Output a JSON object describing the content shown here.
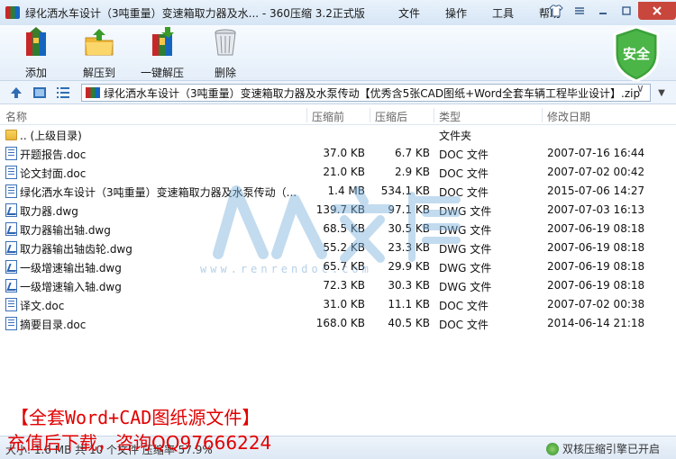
{
  "window": {
    "title": "绿化洒水车设计（3吨重量）变速箱取力器及水... - 360压缩 3.2正式版",
    "menu": [
      "文件",
      "操作",
      "工具",
      "帮助"
    ]
  },
  "toolbar": {
    "add": "添加",
    "extract_to": "解压到",
    "one_click_extract": "一键解压",
    "delete": "删除",
    "security_badge": "安全"
  },
  "address": {
    "path": "绿化洒水车设计（3吨重量）变速箱取力器及水泵传动【优秀含5张CAD图纸+Word全套车辆工程毕业设计】.zip"
  },
  "columns": {
    "name": "名称",
    "compressed": "压缩前",
    "packed": "压缩后",
    "type": "类型",
    "modified": "修改日期"
  },
  "files": [
    {
      "name": ".. (上级目录)",
      "icon": "folder-icon",
      "size": "",
      "packed": "",
      "type": "文件夹",
      "date": ""
    },
    {
      "name": "开题报告.doc",
      "icon": "doc-icon",
      "size": "37.0 KB",
      "packed": "6.7 KB",
      "type": "DOC 文件",
      "date": "2007-07-16 16:44"
    },
    {
      "name": "论文封面.doc",
      "icon": "doc-icon",
      "size": "21.0 KB",
      "packed": "2.9 KB",
      "type": "DOC 文件",
      "date": "2007-07-02 00:42"
    },
    {
      "name": "绿化洒水车设计（3吨重量）变速箱取力器及水泵传动（...",
      "icon": "doc-icon",
      "size": "1.4 MB",
      "packed": "534.1 KB",
      "type": "DOC 文件",
      "date": "2015-07-06 14:27"
    },
    {
      "name": "取力器.dwg",
      "icon": "dwg-icon",
      "size": "139.7 KB",
      "packed": "97.1 KB",
      "type": "DWG 文件",
      "date": "2007-07-03 16:13"
    },
    {
      "name": "取力器输出轴.dwg",
      "icon": "dwg-icon",
      "size": "68.5 KB",
      "packed": "30.5 KB",
      "type": "DWG 文件",
      "date": "2007-06-19 08:18"
    },
    {
      "name": "取力器输出轴齿轮.dwg",
      "icon": "dwg-icon",
      "size": "55.2 KB",
      "packed": "23.3 KB",
      "type": "DWG 文件",
      "date": "2007-06-19 08:18"
    },
    {
      "name": "一级增速输出轴.dwg",
      "icon": "dwg-icon",
      "size": "65.7 KB",
      "packed": "29.9 KB",
      "type": "DWG 文件",
      "date": "2007-06-19 08:18"
    },
    {
      "name": "一级增速输入轴.dwg",
      "icon": "dwg-icon",
      "size": "72.3 KB",
      "packed": "30.3 KB",
      "type": "DWG 文件",
      "date": "2007-06-19 08:18"
    },
    {
      "name": "译文.doc",
      "icon": "doc-icon",
      "size": "31.0 KB",
      "packed": "11.1 KB",
      "type": "DOC 文件",
      "date": "2007-07-02 00:38"
    },
    {
      "name": "摘要目录.doc",
      "icon": "doc-icon",
      "size": "168.0 KB",
      "packed": "40.5 KB",
      "type": "DOC 文件",
      "date": "2014-06-14 21:18"
    }
  ],
  "watermark": {
    "url": "www.renrendoc.com"
  },
  "ad": {
    "line1": "【全套Word+CAD图纸源文件】",
    "line2": "充值后下载，咨询QQ97666224"
  },
  "status": {
    "left": "大小: 1.6 MB 共 10 个文件 压缩率 57.9%",
    "right": "双核压缩引擎已开启"
  },
  "colors": {
    "accent": "#2f6db5",
    "ad_red": "#e10000",
    "shield_green": "#3aa13a"
  }
}
